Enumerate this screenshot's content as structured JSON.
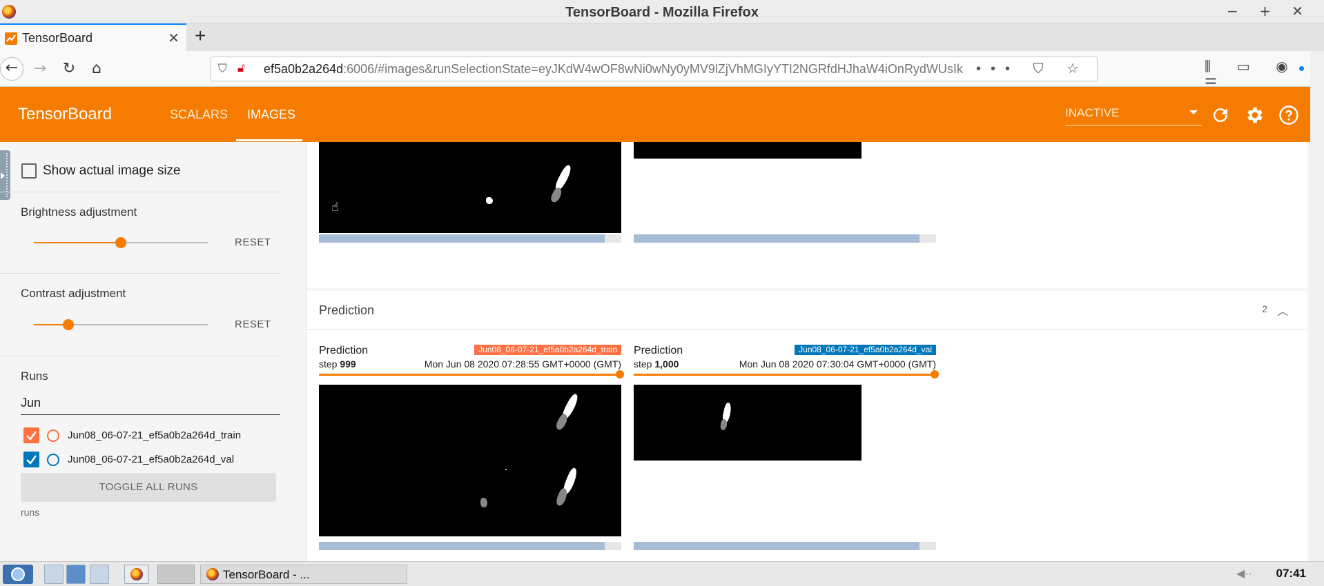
{
  "window": {
    "title": "TensorBoard - Mozilla Firefox",
    "controls": [
      "−",
      "+",
      "✕"
    ]
  },
  "browser": {
    "tab_title": "TensorBoard",
    "tab_close": "✕",
    "new_tab": "+",
    "url_host": "ef5a0b2a264d",
    "url_rest": ":6006/#images&runSelectionState=eyJKdW4wOF8wNi0wNy0yMV9lZjVhMGIyYTI2NGRfdHJhaW4iOnRydWUsIk",
    "page_action_icons": "••• ⛉ ☆",
    "toolbar_icons": "⫼ ▭ ◉"
  },
  "tensorboard": {
    "brand": "TensorBoard",
    "tabs": [
      "SCALARS",
      "IMAGES"
    ],
    "active_tab": "IMAGES",
    "run_selector_value": "INACTIVE",
    "accent_color": "#f57c00"
  },
  "sidebar": {
    "show_actual_size_label": "Show actual image size",
    "show_actual_size_checked": false,
    "brightness": {
      "label": "Brightness adjustment",
      "value": 0.5,
      "reset": "RESET"
    },
    "contrast": {
      "label": "Contrast adjustment",
      "value": 0.2,
      "reset": "RESET"
    },
    "runs_heading": "Runs",
    "runs_filter": "Jun",
    "runs": [
      {
        "name": "Jun08_06-07-21_ef5a0b2a264d_train",
        "color": "#ff7043",
        "checked": true
      },
      {
        "name": "Jun08_06-07-21_ef5a0b2a264d_val",
        "color": "#0077bb",
        "checked": true
      }
    ],
    "toggle_all": "TOGGLE ALL RUNS",
    "footer": "runs"
  },
  "main": {
    "top_cards": [
      {
        "step_fraction": 0.946
      },
      {
        "step_fraction": 0.946
      }
    ],
    "prediction_section": {
      "title": "Prediction",
      "count": "2",
      "cards": [
        {
          "tag": "Prediction",
          "run": "Jun08_06-07-21_ef5a0b2a264d_train",
          "run_color": "#ff7043",
          "step_label": "step",
          "step": "999",
          "time": "Mon Jun 08 2020 07:28:55 GMT+0000 (GMT)",
          "step_fraction": 0.946
        },
        {
          "tag": "Prediction",
          "run": "Jun08_06-07-21_ef5a0b2a264d_val",
          "run_color": "#0077bb",
          "step_label": "step",
          "step": "1,000",
          "time": "Mon Jun 08 2020 07:30:04 GMT+0000 (GMT)",
          "step_fraction": 0.946
        }
      ]
    }
  },
  "taskbar": {
    "task_label": "TensorBoard - ...",
    "clock": "07:41"
  }
}
